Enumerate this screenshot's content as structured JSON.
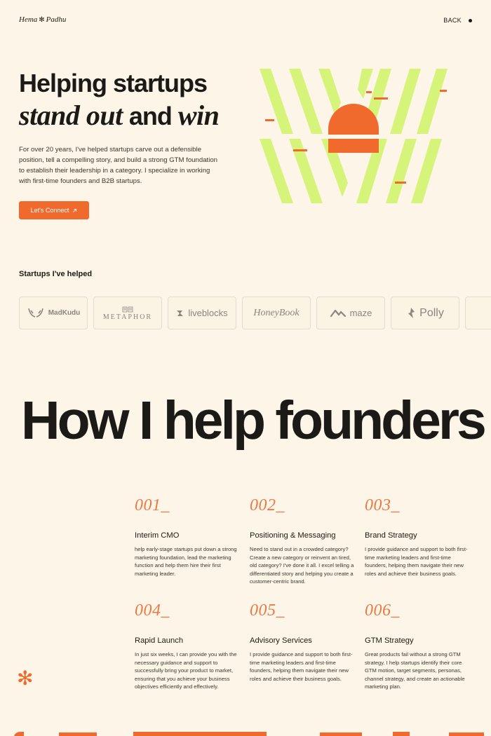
{
  "header": {
    "logo_first": "Hema",
    "logo_second": "Padhu",
    "back_label": "BACK"
  },
  "hero": {
    "title_line1": "Helping startups",
    "title_italic1": "stand out",
    "title_and": "and",
    "title_italic2": "win",
    "description": "For over 20 years, I've helped startups carve out a defensible position, tell a compelling story, and build a strong GTM foundation to establish their leadership in a category. I specialize in working with first-time founders and B2B startups.",
    "cta_label": "Let's Connect",
    "cta_icon": "arrow-up-right-icon"
  },
  "startups": {
    "title": "Startups I've helped",
    "logos": [
      "MadKudu",
      "METAPHOR",
      "liveblocks",
      "HoneyBook",
      "maze",
      "Polly"
    ]
  },
  "services_section": {
    "heading": "How I help founders",
    "items": [
      {
        "num": "001_",
        "title": "Interim CMO",
        "desc": " help early-stage startups put down a strong marketing foundation, lead the marketing function and help them hire their first marketing leader."
      },
      {
        "num": "002_",
        "title": "Positioning & Messaging",
        "desc": "Need to stand out in a crowded category? Create a new category or reinvent an tired, old category? I've done it all. I excel telling a differentiated story and helping you create a customer-centric brand."
      },
      {
        "num": "003_",
        "title": "Brand Strategy",
        "desc": "I provide guidance and support to both first-time marketing leaders and first-time founders, helping them navigate their new roles and achieve their business goals."
      },
      {
        "num": "004_",
        "title": "Rapid Launch",
        "desc": "In just six weeks, I can provide you with the necessary guidance and support to successfully bring your product to market, ensuring that you achieve your business objectives efficiently and effectively."
      },
      {
        "num": "005_",
        "title": "Advisory Services",
        "desc": "I provide guidance and support to both first-time marketing leaders and first-time founders, helping them navigate their new roles and achieve their business goals."
      },
      {
        "num": "006_",
        "title": "GTM Strategy",
        "desc": "Great products fail without a strong GTM strategy. I help startups identify their core GTM motion, target segments, personas, channel strategy, and create an actionable marketing plan."
      }
    ]
  },
  "colors": {
    "background": "#fdf5e7",
    "accent": "#f16a2d",
    "lime": "#d6f47a",
    "text": "#1c1a17"
  }
}
